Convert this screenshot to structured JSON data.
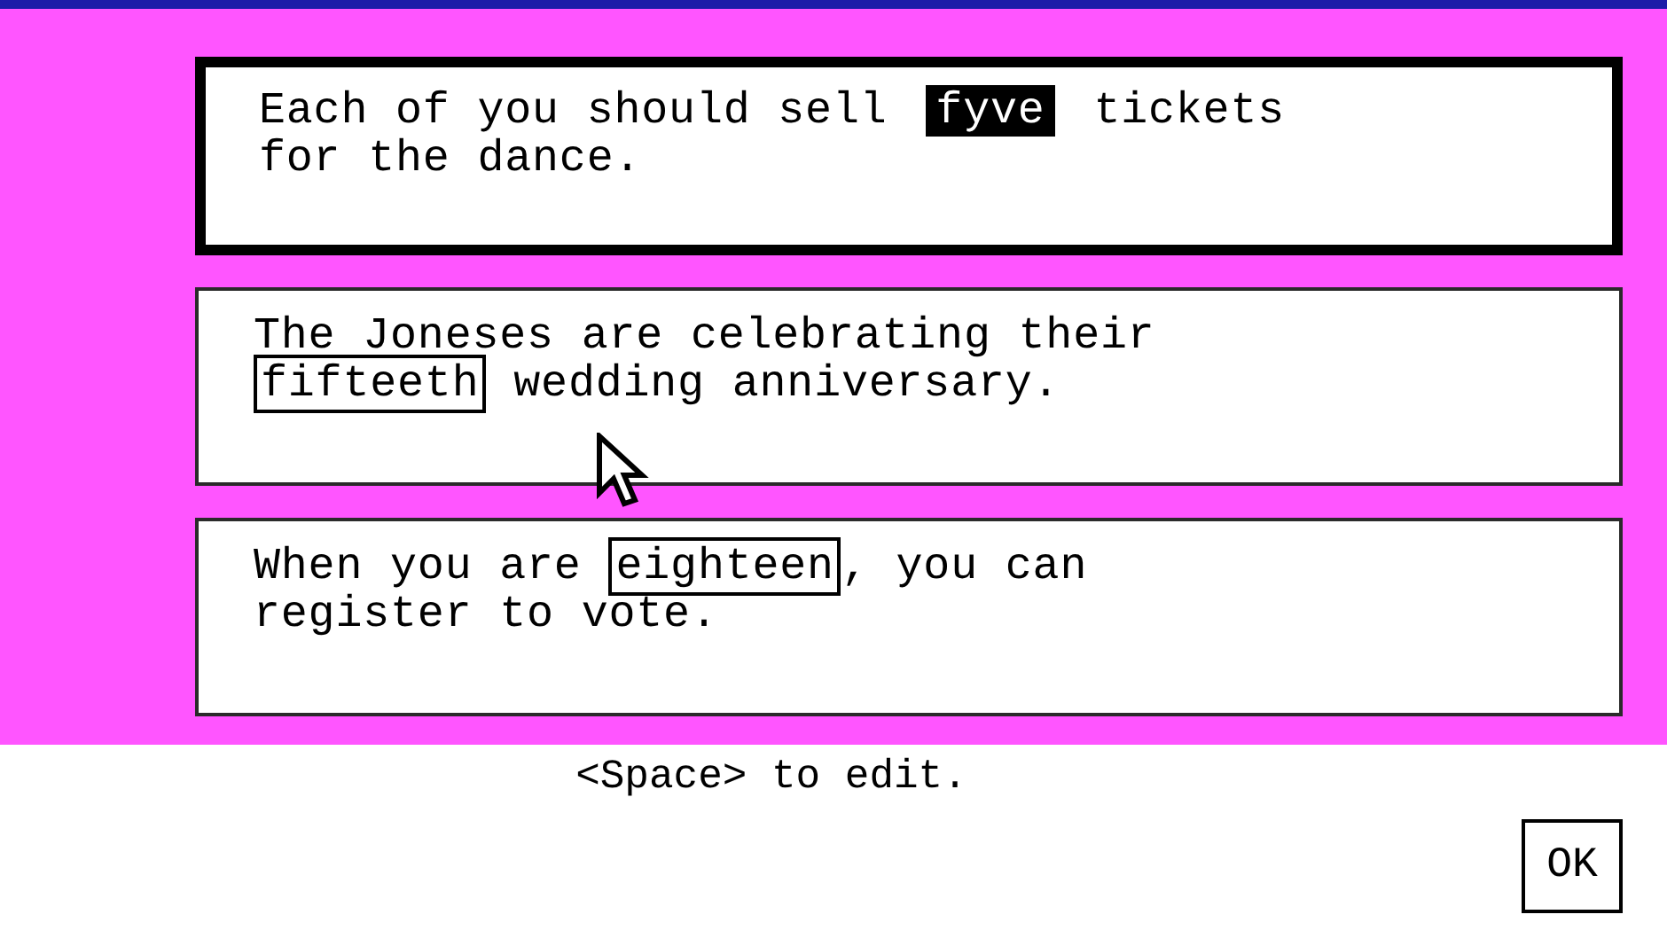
{
  "sentences": [
    {
      "selected": true,
      "parts": [
        {
          "kind": "text",
          "text": "Each of you should sell "
        },
        {
          "kind": "word",
          "text": "fyve"
        },
        {
          "kind": "text",
          "text": " tickets"
        },
        {
          "kind": "break"
        },
        {
          "kind": "text",
          "text": "for the dance."
        }
      ]
    },
    {
      "selected": false,
      "parts": [
        {
          "kind": "text",
          "text": "The Joneses are celebrating their"
        },
        {
          "kind": "break"
        },
        {
          "kind": "word",
          "text": "fifteeth"
        },
        {
          "kind": "text",
          "text": " wedding anniversary."
        }
      ]
    },
    {
      "selected": false,
      "parts": [
        {
          "kind": "text",
          "text": "When you are "
        },
        {
          "kind": "word",
          "text": "eighteen"
        },
        {
          "kind": "text",
          "text": ", you can"
        },
        {
          "kind": "break"
        },
        {
          "kind": "text",
          "text": "register to vote."
        }
      ]
    }
  ],
  "hint": "<Space> to edit.",
  "ok_button": "OK"
}
